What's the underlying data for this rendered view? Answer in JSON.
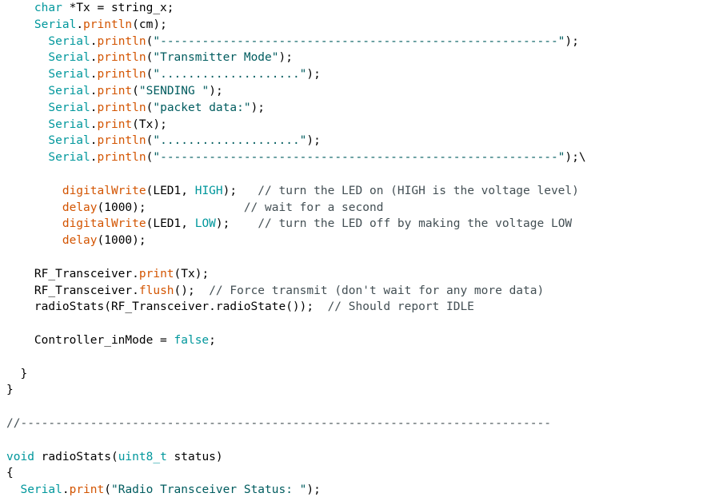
{
  "colors": {
    "background": "#ffffff",
    "plain": "#000000",
    "keyword": "#00979c",
    "function": "#d35400",
    "string": "#005c5f",
    "comment": "#434f54"
  },
  "lines": [
    [
      {
        "t": "    ",
        "c": "plain"
      },
      {
        "t": "char",
        "c": "key"
      },
      {
        "t": " *Tx = string_x;",
        "c": "plain"
      }
    ],
    [
      {
        "t": "    ",
        "c": "plain"
      },
      {
        "t": "Serial",
        "c": "key"
      },
      {
        "t": ".",
        "c": "plain"
      },
      {
        "t": "println",
        "c": "fn"
      },
      {
        "t": "(cm);",
        "c": "plain"
      }
    ],
    [
      {
        "t": "      ",
        "c": "plain"
      },
      {
        "t": "Serial",
        "c": "key"
      },
      {
        "t": ".",
        "c": "plain"
      },
      {
        "t": "println",
        "c": "fn"
      },
      {
        "t": "(",
        "c": "plain"
      },
      {
        "t": "\"---------------------------------------------------------\"",
        "c": "str"
      },
      {
        "t": ");",
        "c": "plain"
      }
    ],
    [
      {
        "t": "      ",
        "c": "plain"
      },
      {
        "t": "Serial",
        "c": "key"
      },
      {
        "t": ".",
        "c": "plain"
      },
      {
        "t": "println",
        "c": "fn"
      },
      {
        "t": "(",
        "c": "plain"
      },
      {
        "t": "\"Transmitter Mode\"",
        "c": "str"
      },
      {
        "t": ");",
        "c": "plain"
      }
    ],
    [
      {
        "t": "      ",
        "c": "plain"
      },
      {
        "t": "Serial",
        "c": "key"
      },
      {
        "t": ".",
        "c": "plain"
      },
      {
        "t": "println",
        "c": "fn"
      },
      {
        "t": "(",
        "c": "plain"
      },
      {
        "t": "\"....................\"",
        "c": "str"
      },
      {
        "t": ");",
        "c": "plain"
      }
    ],
    [
      {
        "t": "      ",
        "c": "plain"
      },
      {
        "t": "Serial",
        "c": "key"
      },
      {
        "t": ".",
        "c": "plain"
      },
      {
        "t": "print",
        "c": "fn"
      },
      {
        "t": "(",
        "c": "plain"
      },
      {
        "t": "\"SENDING \"",
        "c": "str"
      },
      {
        "t": ");",
        "c": "plain"
      }
    ],
    [
      {
        "t": "      ",
        "c": "plain"
      },
      {
        "t": "Serial",
        "c": "key"
      },
      {
        "t": ".",
        "c": "plain"
      },
      {
        "t": "println",
        "c": "fn"
      },
      {
        "t": "(",
        "c": "plain"
      },
      {
        "t": "\"packet data:\"",
        "c": "str"
      },
      {
        "t": ");",
        "c": "plain"
      }
    ],
    [
      {
        "t": "      ",
        "c": "plain"
      },
      {
        "t": "Serial",
        "c": "key"
      },
      {
        "t": ".",
        "c": "plain"
      },
      {
        "t": "print",
        "c": "fn"
      },
      {
        "t": "(Tx);",
        "c": "plain"
      }
    ],
    [
      {
        "t": "      ",
        "c": "plain"
      },
      {
        "t": "Serial",
        "c": "key"
      },
      {
        "t": ".",
        "c": "plain"
      },
      {
        "t": "println",
        "c": "fn"
      },
      {
        "t": "(",
        "c": "plain"
      },
      {
        "t": "\"....................\"",
        "c": "str"
      },
      {
        "t": ");",
        "c": "plain"
      }
    ],
    [
      {
        "t": "      ",
        "c": "plain"
      },
      {
        "t": "Serial",
        "c": "key"
      },
      {
        "t": ".",
        "c": "plain"
      },
      {
        "t": "println",
        "c": "fn"
      },
      {
        "t": "(",
        "c": "plain"
      },
      {
        "t": "\"---------------------------------------------------------\"",
        "c": "str"
      },
      {
        "t": ");\\",
        "c": "plain"
      }
    ],
    [],
    [
      {
        "t": "        ",
        "c": "plain"
      },
      {
        "t": "digitalWrite",
        "c": "fn"
      },
      {
        "t": "(LED1, ",
        "c": "plain"
      },
      {
        "t": "HIGH",
        "c": "key"
      },
      {
        "t": ");   ",
        "c": "plain"
      },
      {
        "t": "// turn the LED on (HIGH is the voltage level)",
        "c": "com"
      }
    ],
    [
      {
        "t": "        ",
        "c": "plain"
      },
      {
        "t": "delay",
        "c": "fn"
      },
      {
        "t": "(1000);              ",
        "c": "plain"
      },
      {
        "t": "// wait for a second",
        "c": "com"
      }
    ],
    [
      {
        "t": "        ",
        "c": "plain"
      },
      {
        "t": "digitalWrite",
        "c": "fn"
      },
      {
        "t": "(LED1, ",
        "c": "plain"
      },
      {
        "t": "LOW",
        "c": "key"
      },
      {
        "t": ");    ",
        "c": "plain"
      },
      {
        "t": "// turn the LED off by making the voltage LOW",
        "c": "com"
      }
    ],
    [
      {
        "t": "        ",
        "c": "plain"
      },
      {
        "t": "delay",
        "c": "fn"
      },
      {
        "t": "(1000);",
        "c": "plain"
      }
    ],
    [],
    [
      {
        "t": "    RF_Transceiver.",
        "c": "plain"
      },
      {
        "t": "print",
        "c": "fn"
      },
      {
        "t": "(Tx);",
        "c": "plain"
      }
    ],
    [
      {
        "t": "    RF_Transceiver.",
        "c": "plain"
      },
      {
        "t": "flush",
        "c": "fn"
      },
      {
        "t": "();  ",
        "c": "plain"
      },
      {
        "t": "// Force transmit (don't wait for any more data)",
        "c": "com"
      }
    ],
    [
      {
        "t": "    radioStats(RF_Transceiver.radioState());  ",
        "c": "plain"
      },
      {
        "t": "// Should report IDLE",
        "c": "com"
      }
    ],
    [],
    [
      {
        "t": "    Controller_inMode = ",
        "c": "plain"
      },
      {
        "t": "false",
        "c": "key"
      },
      {
        "t": ";",
        "c": "plain"
      }
    ],
    [],
    [
      {
        "t": "  }",
        "c": "plain"
      }
    ],
    [
      {
        "t": "}",
        "c": "plain"
      }
    ],
    [],
    [
      {
        "t": "//----------------------------------------------------------------------------",
        "c": "com"
      }
    ],
    [],
    [
      {
        "t": "void",
        "c": "key"
      },
      {
        "t": " radioStats(",
        "c": "plain"
      },
      {
        "t": "uint8_t",
        "c": "key"
      },
      {
        "t": " status)",
        "c": "plain"
      }
    ],
    [
      {
        "t": "{",
        "c": "plain"
      }
    ],
    [
      {
        "t": "  ",
        "c": "plain"
      },
      {
        "t": "Serial",
        "c": "key"
      },
      {
        "t": ".",
        "c": "plain"
      },
      {
        "t": "print",
        "c": "fn"
      },
      {
        "t": "(",
        "c": "plain"
      },
      {
        "t": "\"Radio Transceiver Status: \"",
        "c": "str"
      },
      {
        "t": ");",
        "c": "plain"
      }
    ]
  ]
}
